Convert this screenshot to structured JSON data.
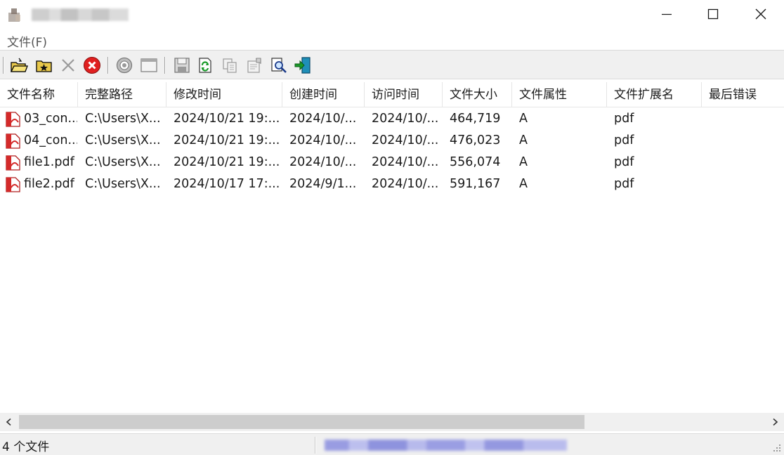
{
  "window": {
    "title": "",
    "controls": {
      "minimize_icon": "minimize-icon",
      "maximize_icon": "maximize-icon",
      "close_icon": "close-icon"
    }
  },
  "menu": {
    "items": [
      {
        "label": "文件(F)"
      }
    ]
  },
  "toolbar": {
    "buttons": [
      {
        "icon": "open-folder-icon"
      },
      {
        "icon": "favorite-folder-icon"
      },
      {
        "icon": "remove-icon"
      },
      {
        "icon": "stop-icon"
      },
      {
        "icon": "options-icon"
      },
      {
        "icon": "window-icon"
      },
      {
        "icon": "save-icon"
      },
      {
        "icon": "refresh-icon"
      },
      {
        "icon": "copy-icon"
      },
      {
        "icon": "properties-icon"
      },
      {
        "icon": "find-icon"
      },
      {
        "icon": "exit-icon"
      }
    ]
  },
  "list": {
    "columns": [
      "文件名称",
      "完整路径",
      "修改时间",
      "创建时间",
      "访问时间",
      "文件大小",
      "文件属性",
      "文件扩展名",
      "最后错误"
    ],
    "rows": [
      [
        "03_con...",
        "C:\\Users\\X...",
        "2024/10/21 19:...",
        "2024/10/...",
        "2024/10/...",
        "464,719",
        "A",
        "pdf",
        ""
      ],
      [
        "04_con...",
        "C:\\Users\\X...",
        "2024/10/21 19:...",
        "2024/10/...",
        "2024/10/...",
        "476,023",
        "A",
        "pdf",
        ""
      ],
      [
        "file1.pdf",
        "C:\\Users\\X...",
        "2024/10/21 19:...",
        "2024/10/...",
        "2024/10/...",
        "556,074",
        "A",
        "pdf",
        ""
      ],
      [
        "file2.pdf",
        "C:\\Users\\X...",
        "2024/10/17 17:...",
        "2024/9/1...",
        "2024/10/...",
        "591,167",
        "A",
        "pdf",
        ""
      ]
    ]
  },
  "status": {
    "count_text": "4 个文件"
  },
  "colors": {
    "toolbar_bg": "#f0f0f0",
    "pdf_red": "#d42a2a",
    "stop_red": "#e02020"
  }
}
